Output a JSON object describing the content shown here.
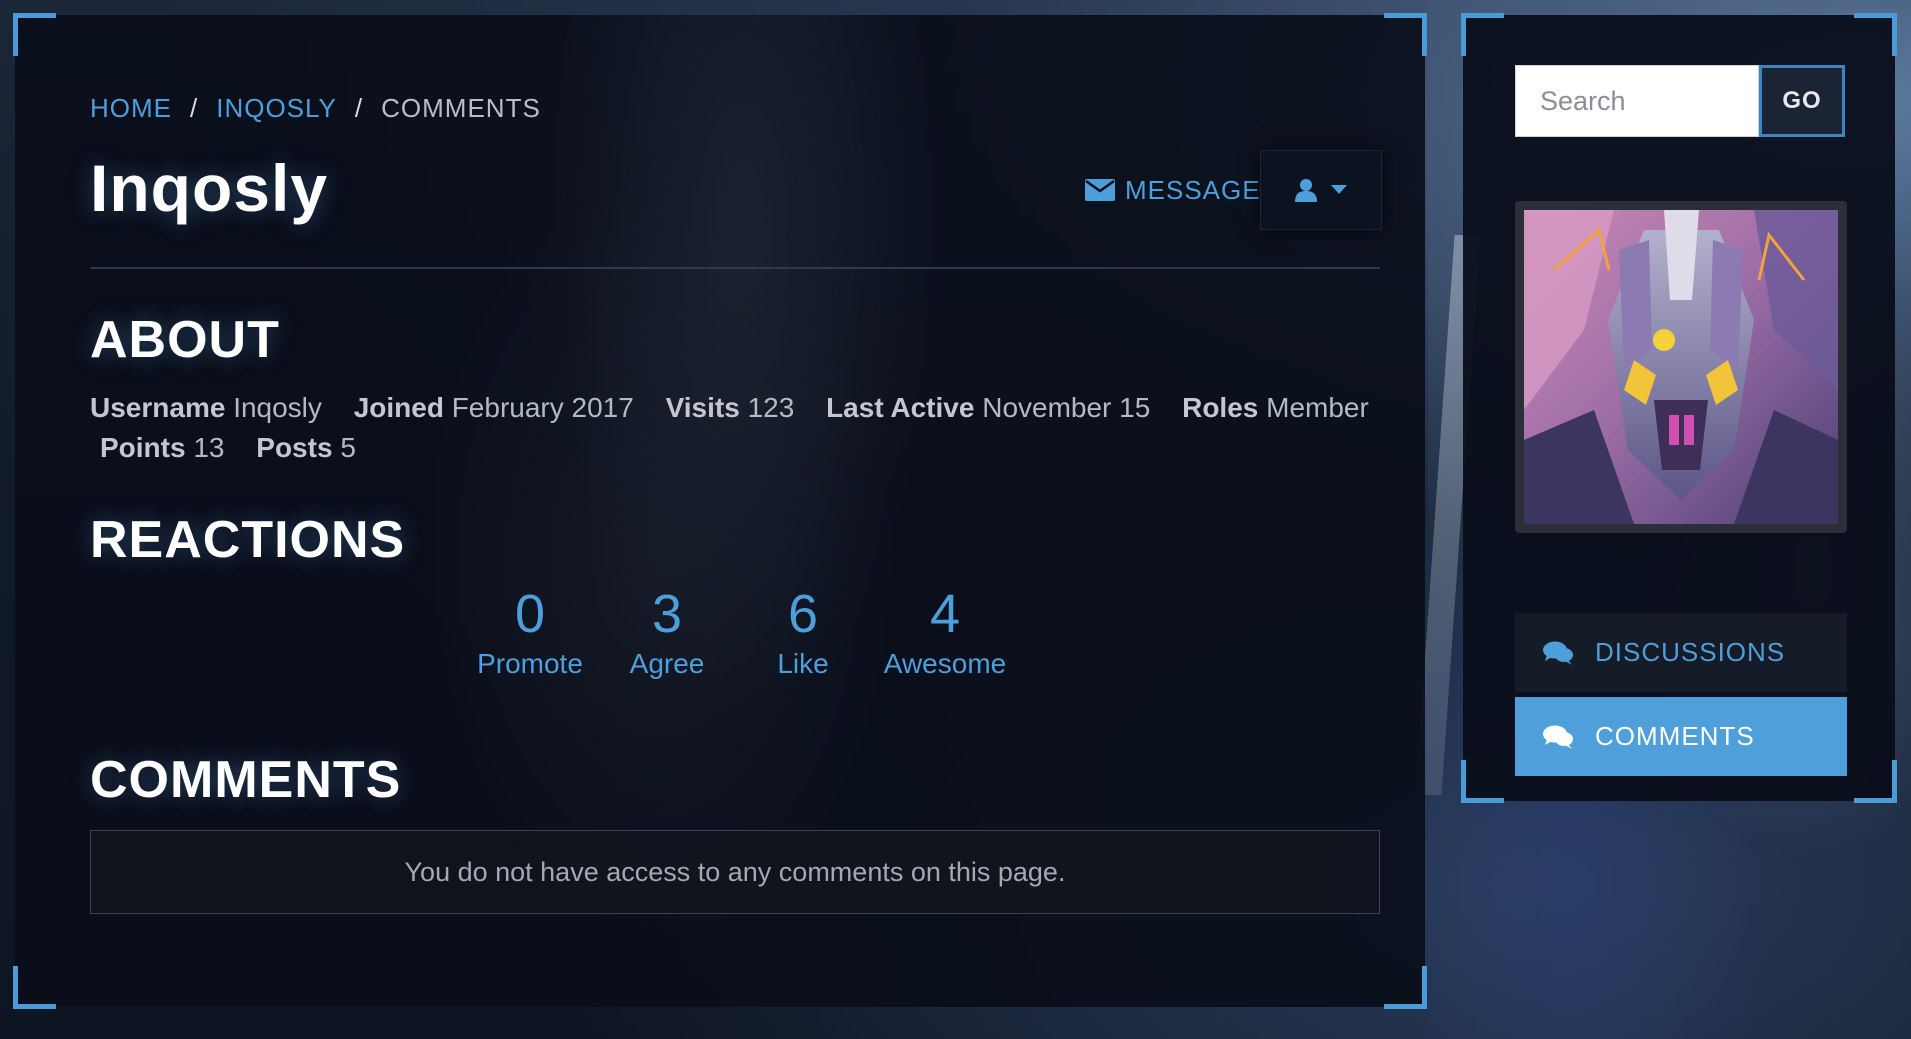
{
  "breadcrumb": {
    "home": "Home",
    "user": "Inqosly",
    "current": "Comments",
    "separator": "/"
  },
  "profile": {
    "name": "Inqosly",
    "message_label": "Message"
  },
  "about": {
    "heading": "About",
    "username_key": "Username",
    "username_value": "Inqosly",
    "joined_key": "Joined",
    "joined_value": "February 2017",
    "visits_key": "Visits",
    "visits_value": "123",
    "last_active_key": "Last Active",
    "last_active_value": "November 15",
    "roles_key": "Roles",
    "roles_value": "Member",
    "points_key": "Points",
    "points_value": "13",
    "posts_key": "Posts",
    "posts_value": "5"
  },
  "reactions": {
    "heading": "Reactions",
    "items": [
      {
        "count": "0",
        "label": "Promote"
      },
      {
        "count": "3",
        "label": "Agree"
      },
      {
        "count": "6",
        "label": "Like"
      },
      {
        "count": "4",
        "label": "Awesome"
      }
    ]
  },
  "comments": {
    "heading": "Comments",
    "notice": "You do not have access to any comments on this page."
  },
  "sidebar": {
    "search_placeholder": "Search",
    "search_value": "",
    "go_label": "Go",
    "nav": [
      {
        "label": "Discussions",
        "icon": "comments-icon",
        "active": false
      },
      {
        "label": "Comments",
        "icon": "comments-icon",
        "active": true
      }
    ]
  },
  "colors": {
    "accent": "#4d9fdc",
    "active_nav": "#4e9fda",
    "panel": "#0a0e1a"
  }
}
